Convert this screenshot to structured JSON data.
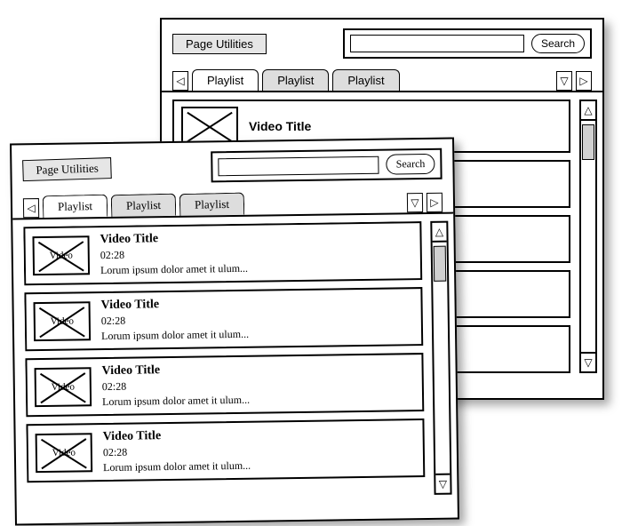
{
  "back": {
    "pageUtilLabel": "Page Utilities",
    "searchLabel": "Search",
    "searchPlaceholder": "",
    "tabs": [
      "Playlist",
      "Playlist",
      "Playlist"
    ],
    "firstRow": {
      "title": "Video Title"
    }
  },
  "front": {
    "pageUtilLabel": "Page Utilities",
    "searchLabel": "Search",
    "searchPlaceholder": "",
    "tabs": [
      "Playlist",
      "Playlist",
      "Playlist"
    ],
    "thumbLabel": "Video",
    "videos": [
      {
        "title": "Video Title",
        "time": "02:28",
        "desc": "Lorum ipsum dolor amet it ulum..."
      },
      {
        "title": "Video Title",
        "time": "02:28",
        "desc": "Lorum ipsum dolor amet it ulum..."
      },
      {
        "title": "Video Title",
        "time": "02:28",
        "desc": "Lorum ipsum dolor amet it ulum..."
      },
      {
        "title": "Video Title",
        "time": "02:28",
        "desc": "Lorum ipsum dolor amet it ulum..."
      }
    ]
  }
}
